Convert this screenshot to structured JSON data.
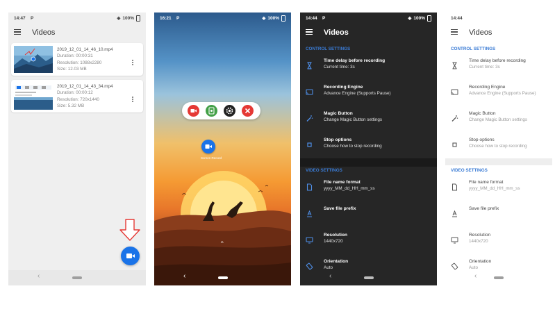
{
  "colors": {
    "accent": "#1a73e8",
    "record_red": "#e53935",
    "screenshot_green": "#43a047",
    "dark_bg": "#262626",
    "section_blue": "#3a7bd5"
  },
  "phone1": {
    "status": {
      "time": "14:47",
      "p": "P",
      "battery": "100%"
    },
    "title": "Videos",
    "videos": [
      {
        "name": "2019_12_01_14_46_10.mp4",
        "duration": "Duration: 00:00:31",
        "resolution": "Resolution: 1088x2280",
        "size": "Size: 12.03 MB"
      },
      {
        "name": "2019_12_01_14_43_34.mp4",
        "duration": "Duration: 00:00:12",
        "resolution": "Resolution: 720x1440",
        "size": "Size: 5.32 MB"
      }
    ],
    "fab_icon": "video-camera-icon"
  },
  "phone2": {
    "status": {
      "time": "16:21",
      "p": "P",
      "battery": "100%"
    },
    "overlay_label": "Screen Record",
    "pill_buttons": [
      "record-icon",
      "screenshot-icon",
      "settings-icon",
      "close-icon"
    ]
  },
  "phone3": {
    "status": {
      "time": "14:44",
      "p": "P",
      "battery": "100%"
    },
    "title": "Videos",
    "control_header": "CONTROL SETTINGS",
    "control_items": [
      {
        "title": "Time delay before recording",
        "sub": "Current time: 3s",
        "icon": "hourglass-icon"
      },
      {
        "title": "Recording Engine",
        "sub": "Advance Engine (Supports Pause)",
        "icon": "cast-icon"
      },
      {
        "title": "Magic Button",
        "sub": "Change Magic Button settings",
        "icon": "magic-wand-icon"
      },
      {
        "title": "Stop options",
        "sub": "Choose how to stop recording",
        "icon": "stop-icon"
      }
    ],
    "video_header": "VIDEO SETTINGS",
    "video_items": [
      {
        "title": "File name format",
        "sub": "yyyy_MM_dd_HH_mm_ss",
        "icon": "file-icon"
      },
      {
        "title": "Save file prefix",
        "sub": "",
        "icon": "text-prefix-icon"
      },
      {
        "title": "Resolution",
        "sub": "1440x720",
        "icon": "monitor-icon"
      },
      {
        "title": "Orientation",
        "sub": "Auto",
        "icon": "rotate-icon"
      }
    ]
  },
  "phone4": {
    "status": {
      "time": "14:44",
      "p": "",
      "battery": ""
    },
    "title": "Videos",
    "control_header": "CONTROL SETTINGS",
    "control_items": [
      {
        "title": "Time delay before recording",
        "sub": "Current time: 3s",
        "icon": "hourglass-icon"
      },
      {
        "title": "Recording Engine",
        "sub": "Advance Engine (Supports Pause)",
        "icon": "cast-icon"
      },
      {
        "title": "Magic Button",
        "sub": "Change Magic Button settings",
        "icon": "magic-wand-icon"
      },
      {
        "title": "Stop options",
        "sub": "Choose how to stop recording",
        "icon": "stop-icon"
      }
    ],
    "video_header": "VIDEO SETTINGS",
    "video_items": [
      {
        "title": "File name format",
        "sub": "yyyy_MM_dd_HH_mm_ss",
        "icon": "file-icon"
      },
      {
        "title": "Save file prefix",
        "sub": "",
        "icon": "text-prefix-icon"
      },
      {
        "title": "Resolution",
        "sub": "1440x720",
        "icon": "monitor-icon"
      },
      {
        "title": "Orientation",
        "sub": "Auto",
        "icon": "rotate-icon"
      }
    ]
  }
}
